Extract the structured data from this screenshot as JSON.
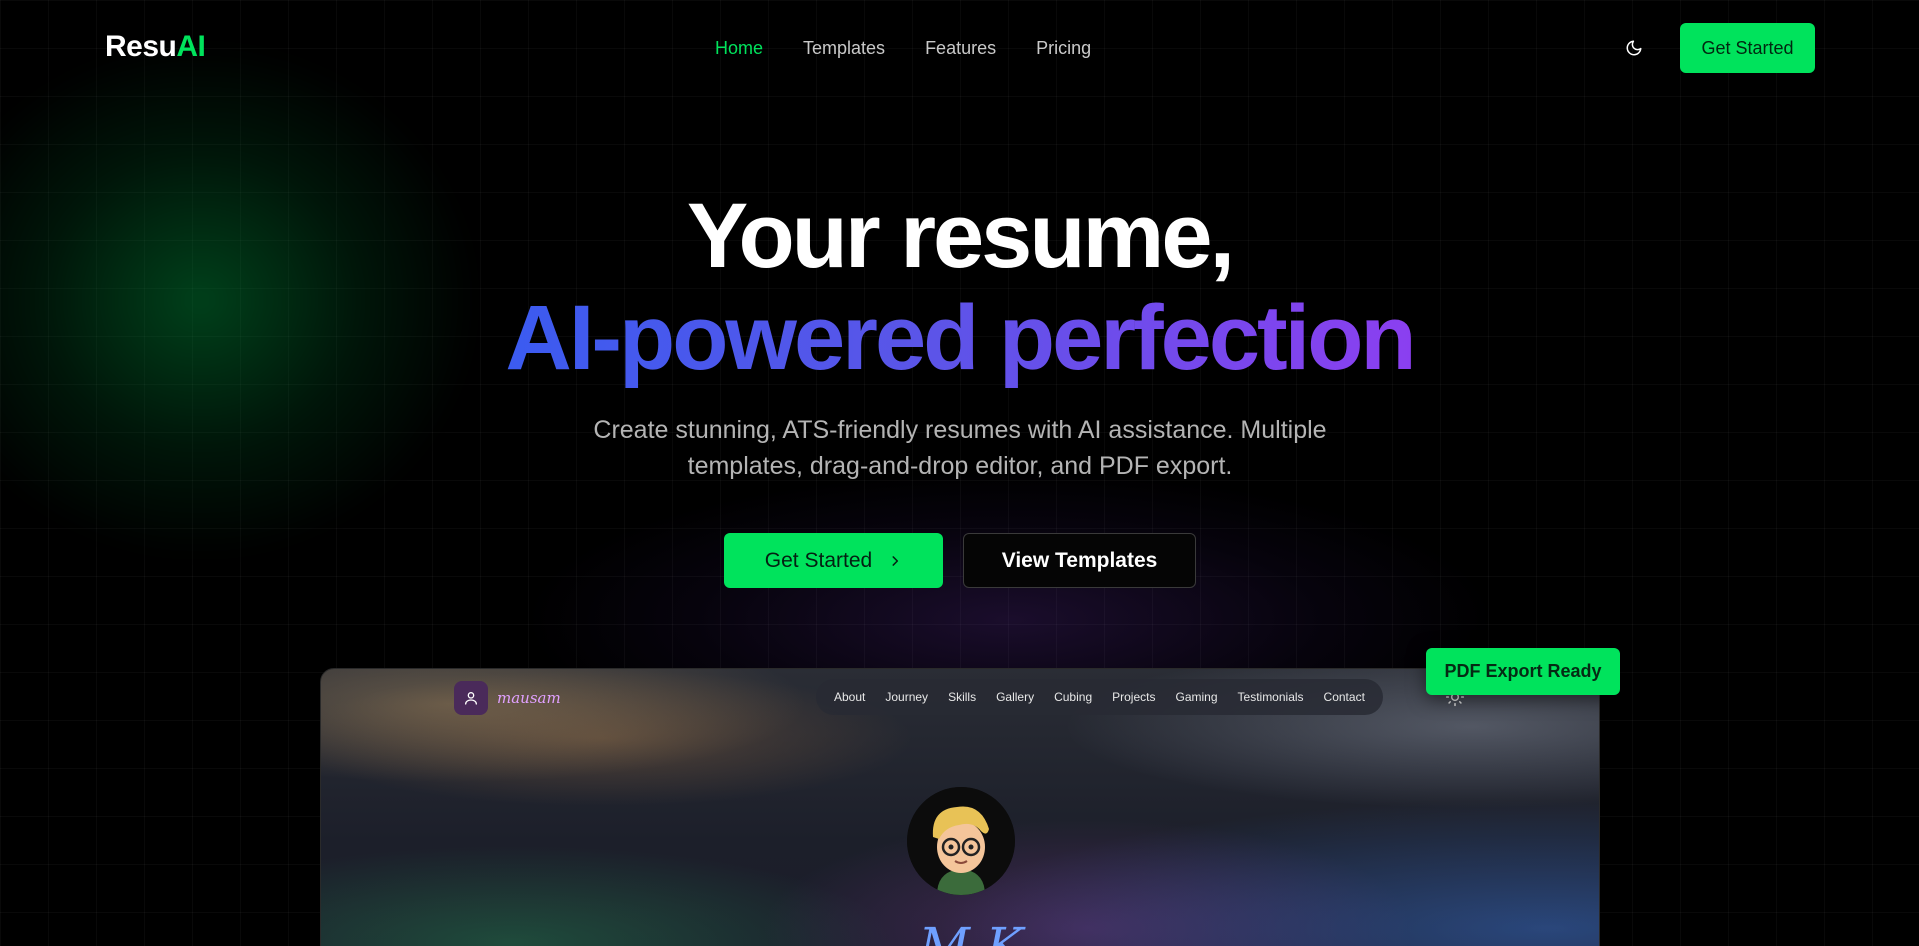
{
  "brand": {
    "name_main": "Resu",
    "name_accent": "AI"
  },
  "nav": {
    "links": [
      {
        "label": "Home",
        "active": true
      },
      {
        "label": "Templates",
        "active": false
      },
      {
        "label": "Features",
        "active": false
      },
      {
        "label": "Pricing",
        "active": false
      }
    ],
    "theme_icon": "moon-icon",
    "cta_label": "Get Started"
  },
  "hero": {
    "line1": "Your resume,",
    "line2": "AI-powered perfection",
    "subtitle": "Create stunning, ATS-friendly resumes with AI assistance. Multiple templates, drag-and-drop editor, and PDF export.",
    "primary_button": "Get Started",
    "primary_icon": "chevron-right-icon",
    "secondary_button": "View Templates"
  },
  "preview": {
    "brand": "mausam",
    "logo_icon": "user-icon",
    "nav_items": [
      "About",
      "Journey",
      "Skills",
      "Gallery",
      "Cubing",
      "Projects",
      "Gaming",
      "Testimonials",
      "Contact"
    ],
    "theme_icon": "sun-icon",
    "name_partial": "M          K"
  },
  "badge": {
    "label": "PDF Export Ready"
  },
  "colors": {
    "accent": "#00e35c",
    "background": "#000000",
    "gradient_start": "#3b5bf0",
    "gradient_end": "#8b3ff0",
    "muted_text": "#b4b4b4"
  }
}
